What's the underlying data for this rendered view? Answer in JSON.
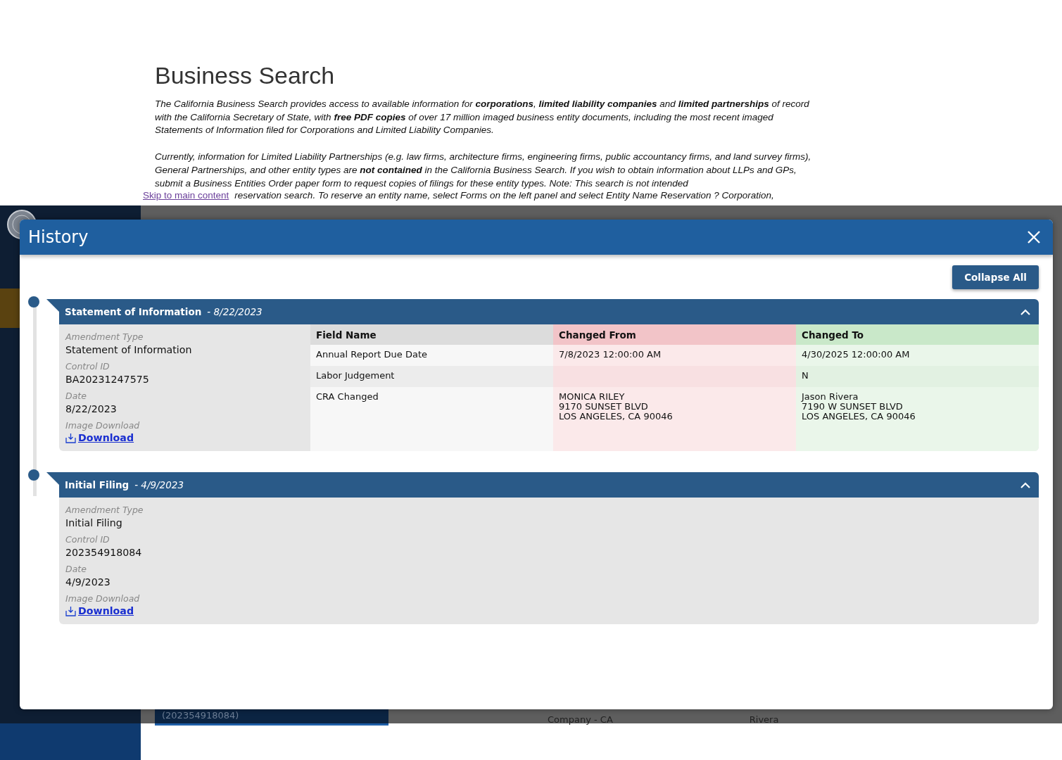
{
  "page": {
    "title": "Business Search",
    "paragraphs": [
      "*The California Business Search provides access to available information for* **corporations**, **limited liability companies** *and* **limited partnerships** *of record with the California Secretary of State, with* **free PDF copies** *of over 17 million imaged business entity documents, including the most recent imaged Statements of Information filed for Corporations and Limited Liability Companies.*",
      "*Currently, information for Limited Liability Partnerships (e.g. law firms, architecture firms, engineering firms, public accountancy firms, and land survey firms), General Partnerships, and other entity types are* **not contained** *in the California Business Search. If you wish to obtain information about LLPs and GPs, submit a Business Entities Order paper form to request copies of filings for these entity types. Note: This search is not intended*"
    ],
    "skip_link": "Skip to main content",
    "paragraph_fragment": "reservation search. To reserve an entity name, select Forms on the left panel and select Entity Name Reservation ? Corporation,",
    "background_row": [
      "(202354918084)",
      "Company - CA",
      "Rivera"
    ]
  },
  "modal": {
    "title": "History",
    "collapse_button": "Collapse All",
    "sections": [
      {
        "title": "Statement of Information",
        "date": "- 8/22/2023",
        "expanded": true,
        "details": [
          {
            "label": "Amendment Type",
            "value": "Statement of Information"
          },
          {
            "label": "Control ID",
            "value": "BA20231247575"
          },
          {
            "label": "Date",
            "value": "8/22/2023"
          }
        ],
        "download_label": "Image Download",
        "download_link": "Download",
        "changes": {
          "columns": [
            "Field Name",
            "Changed From",
            "Changed To"
          ],
          "rows": [
            [
              "Annual Report Due Date",
              "7/8/2023 12:00:00 AM",
              "4/30/2025 12:00:00 AM"
            ],
            [
              "Labor Judgement",
              "",
              "N"
            ],
            [
              "CRA Changed",
              "MONICA RILEY\n9170 SUNSET BLVD\nLOS ANGELES, CA 90046",
              "Jason Rivera\n7190 W SUNSET BLVD\nLOS ANGELES, CA 90046"
            ]
          ]
        }
      },
      {
        "title": "Initial Filing",
        "date": "- 4/9/2023",
        "expanded": true,
        "details": [
          {
            "label": "Amendment Type",
            "value": "Initial Filing"
          },
          {
            "label": "Control ID",
            "value": "202354918084"
          },
          {
            "label": "Date",
            "value": "4/9/2023"
          }
        ],
        "download_label": "Image Download",
        "download_link": "Download"
      }
    ]
  }
}
